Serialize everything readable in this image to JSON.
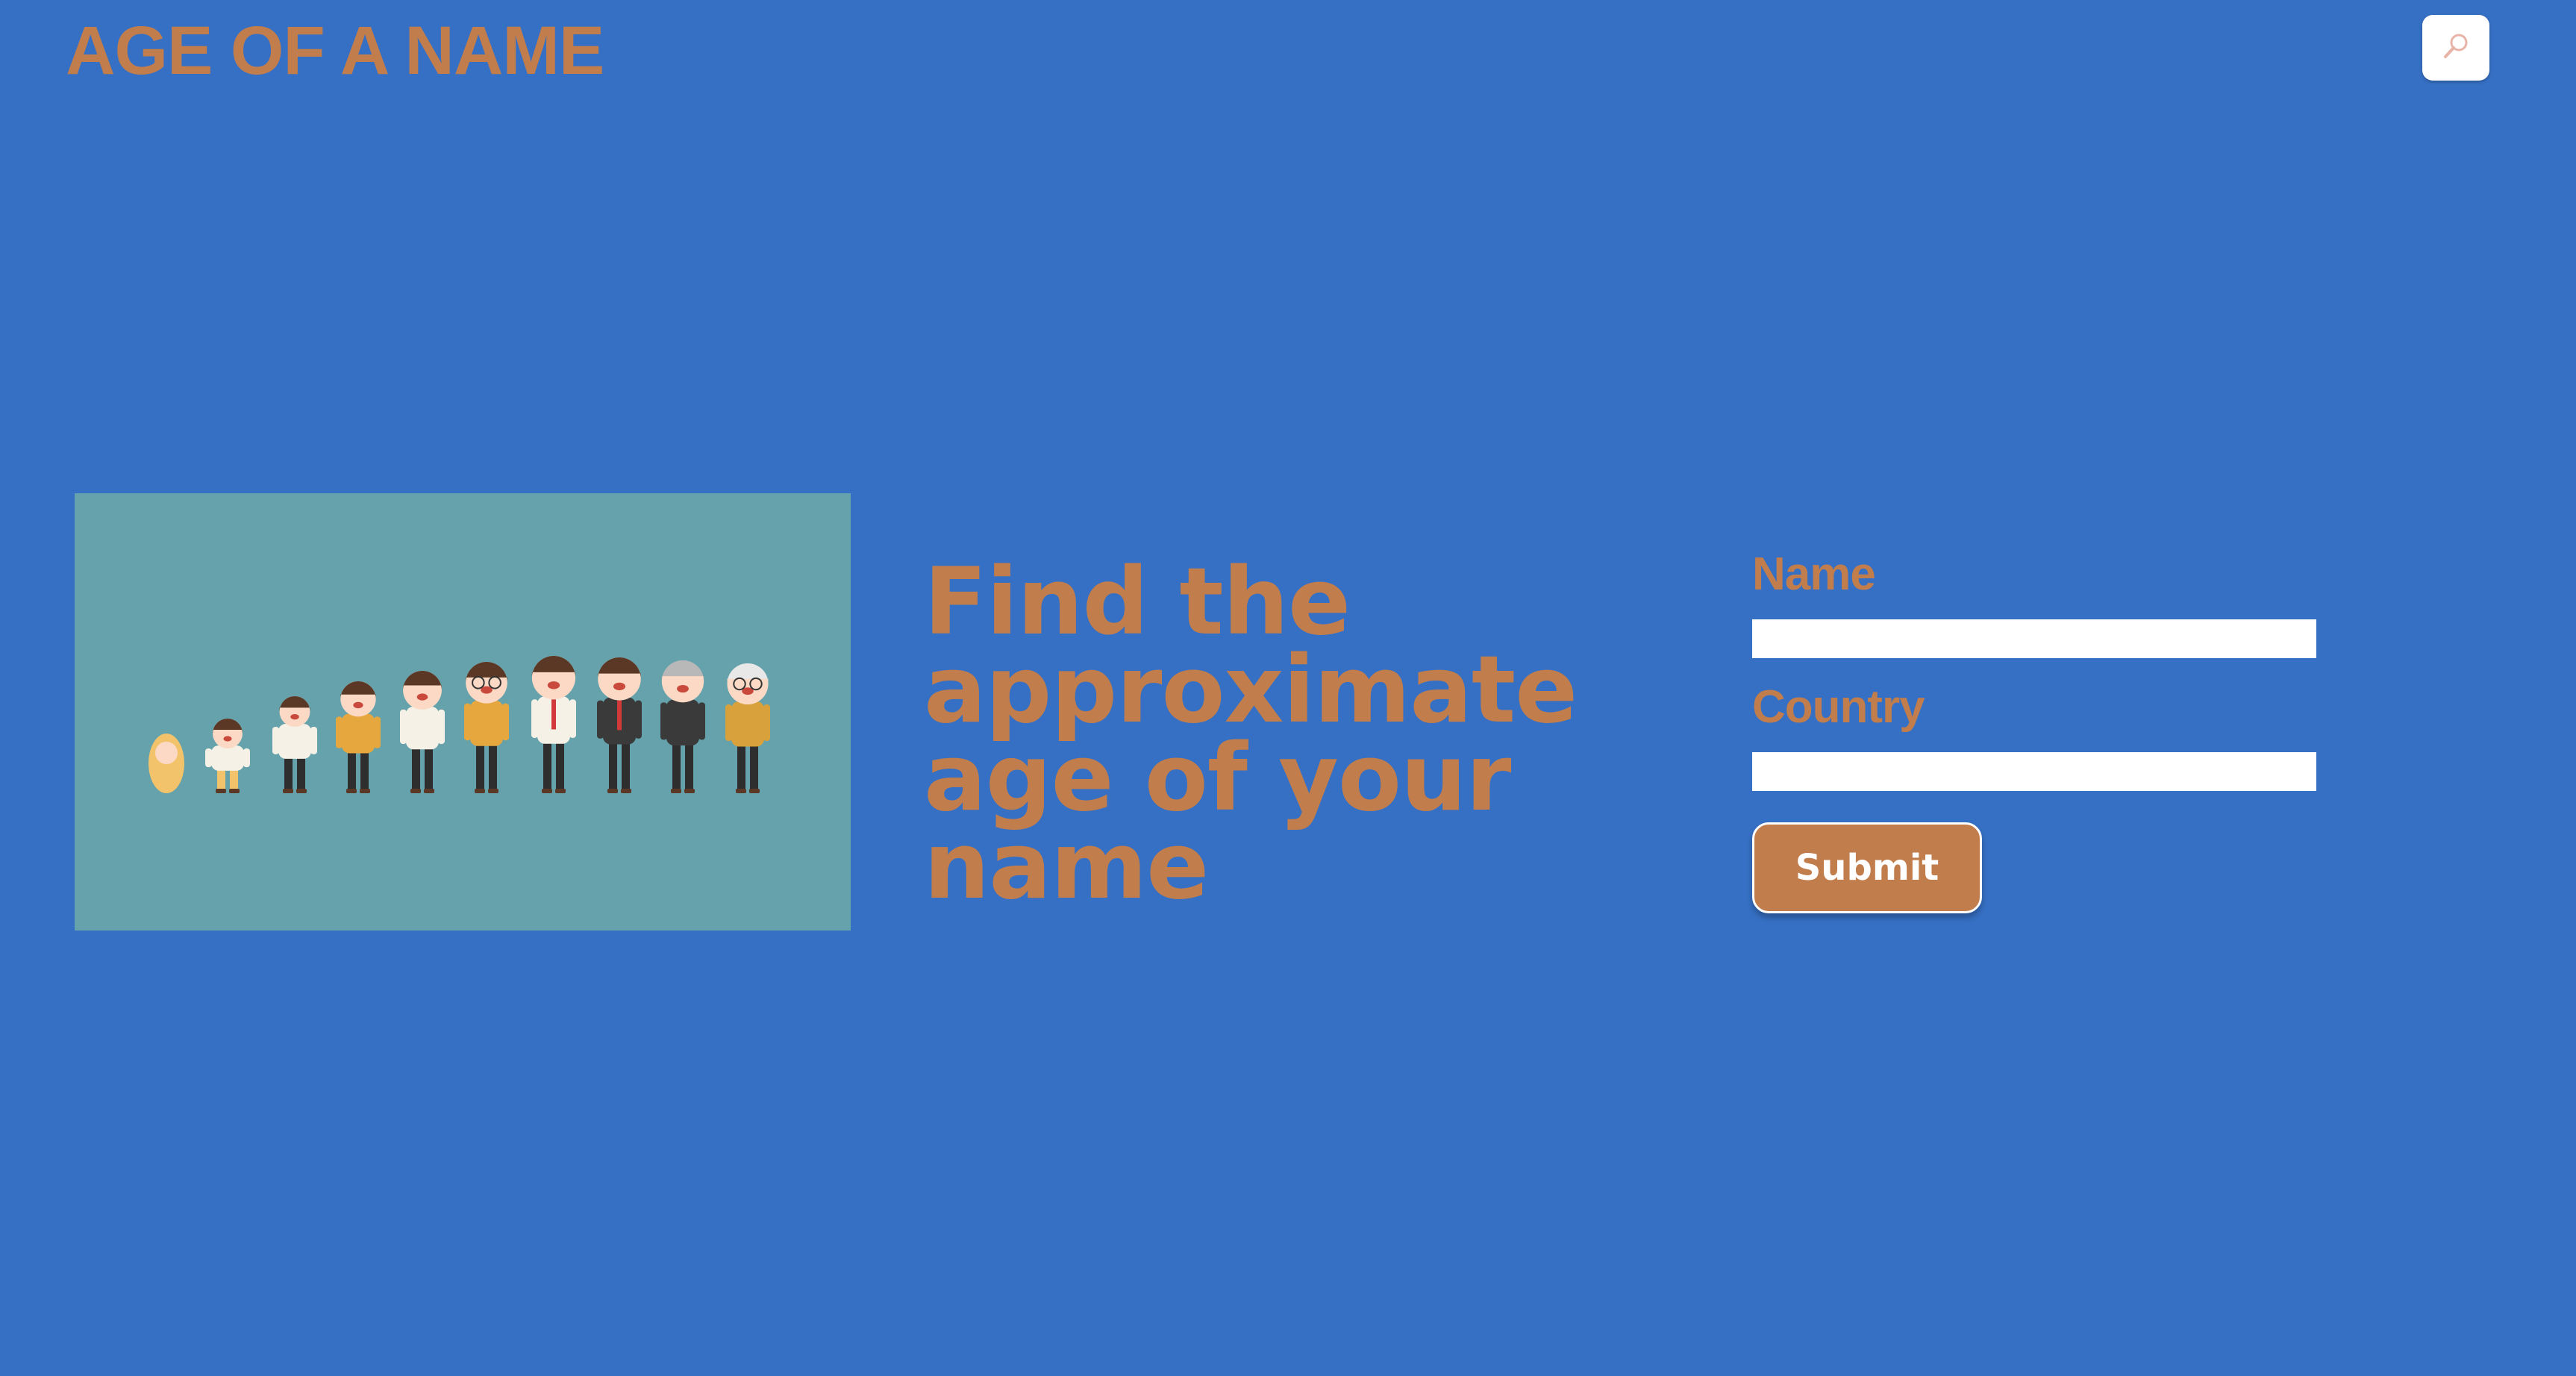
{
  "header": {
    "brand": "AGE OF A NAME",
    "search_icon": "search-icon"
  },
  "hero": {
    "image_subject": "people-age-progression-illustration",
    "headline": "Find the approximate age of your name"
  },
  "form": {
    "name_label": "Name",
    "name_value": "",
    "country_label": "Country",
    "country_value": "",
    "submit_label": "Submit"
  },
  "colors": {
    "background": "#3670C4",
    "accent": "#C27D4C",
    "image_background": "#65A2AB"
  }
}
